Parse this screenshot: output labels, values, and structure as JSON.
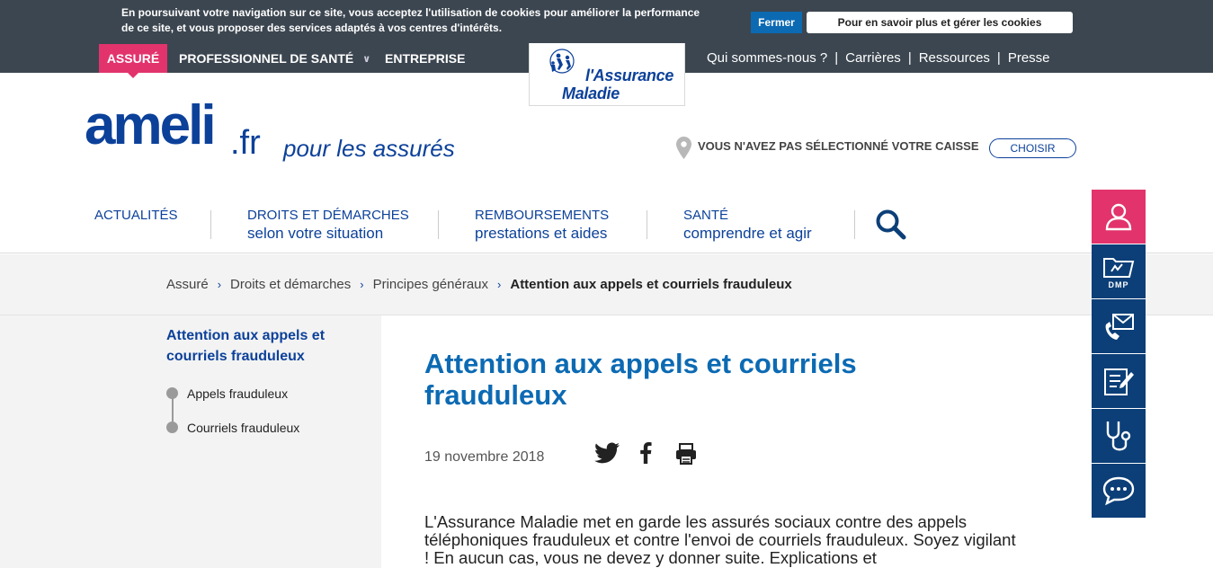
{
  "cookie_banner": {
    "text": "En poursuivant votre navigation sur ce site, vous acceptez l'utilisation de cookies pour améliorer la performance de ce site, et vous proposer des services adaptés à vos centres d'intérêts.",
    "close_label": "Fermer",
    "manage_label": "Pour en savoir plus et gérer les cookies"
  },
  "top_tabs": {
    "assure": "Assuré",
    "pro": "Professionnel de santé",
    "entreprise": "Entreprise"
  },
  "logo": {
    "line1": "l'Assurance",
    "line2": "Maladie",
    "tiny": "SÉCURITÉ SOCIALE"
  },
  "top_links": [
    "Qui sommes-nous ?",
    "Carrières",
    "Ressources",
    "Presse"
  ],
  "brand": {
    "name": "ameli",
    "tld": ".fr",
    "tagline": "pour les assurés"
  },
  "caisse": {
    "text": "VOUS N'AVEZ PAS SÉLECTIONNÉ VOTRE CAISSE",
    "button": "CHOISIR"
  },
  "main_nav": [
    {
      "main": "Actualités",
      "sub": ""
    },
    {
      "main": "Droits et démarches",
      "sub": "selon votre situation"
    },
    {
      "main": "Remboursements",
      "sub": "prestations et aides"
    },
    {
      "main": "Santé",
      "sub": "comprendre et agir"
    }
  ],
  "breadcrumb": [
    "Assuré",
    "Droits et démarches",
    "Principes généraux",
    "Attention aux appels et courriels frauduleux"
  ],
  "sidebar": {
    "title": "Attention aux appels et courriels frauduleux",
    "items": [
      "Appels frauduleux",
      "Courriels frauduleux"
    ]
  },
  "article": {
    "title": "Attention aux appels et courriels frauduleux",
    "date": "19 novembre 2018",
    "body": "L'Assurance Maladie met en garde les assurés sociaux contre des appels téléphoniques frauduleux et contre l'envoi de courriels frauduleux. Soyez vigilant ! En aucun cas, vous ne devez y donner suite. Explications et"
  },
  "side_tools": {
    "dmp_label": "DMP"
  },
  "colors": {
    "dark_bar": "#3c4650",
    "accent_pink": "#e2336c",
    "brand_blue": "#0c419a",
    "title_blue": "#0c6ab3",
    "tool_blue": "#0c3f78"
  }
}
